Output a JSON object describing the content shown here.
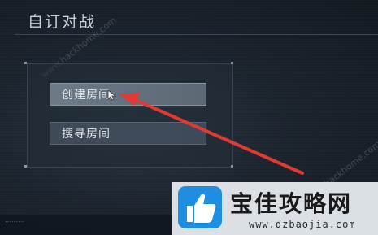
{
  "header": {
    "title": "自订对战"
  },
  "menu": {
    "create_room_label": "创建房间",
    "search_room_label": "搜寻房间"
  },
  "watermarks": [
    "www.hackhome.com",
    "www.hackhome.com"
  ],
  "brand": {
    "name": "宝佳攻略网",
    "url": "www.dzbaojia.com",
    "logo_icon": "thumbs-up-icon",
    "logo_color": "#1e8fe0"
  },
  "annotation": {
    "arrow_color": "#e03a35",
    "arrow_icon": "red-arrow-icon"
  },
  "footer": {
    "status": "⋯⋯⋯"
  }
}
